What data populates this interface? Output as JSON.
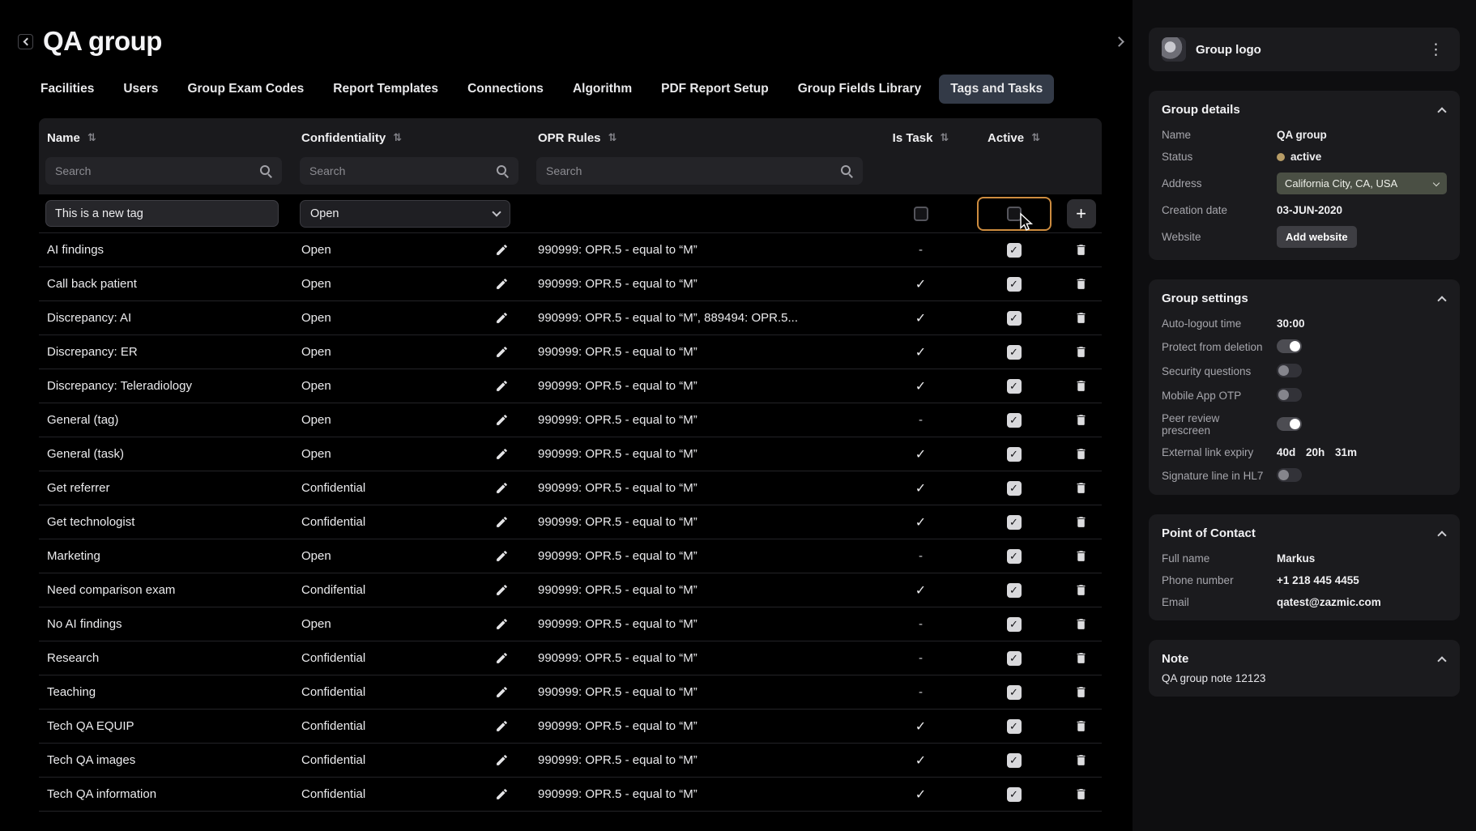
{
  "page": {
    "title": "QA group"
  },
  "icons": {
    "sort": "⇅",
    "kebab": "⋮",
    "check": "✓",
    "dash": "-"
  },
  "colors": {
    "accent_highlight": "#cd8c3f",
    "active_tab_bg": "#333a47",
    "status_dot": "#b79c66",
    "checkbox_checked": "#d9d9dc"
  },
  "tabs": [
    {
      "label": "Facilities",
      "active": false
    },
    {
      "label": "Users",
      "active": false
    },
    {
      "label": "Group Exam Codes",
      "active": false
    },
    {
      "label": "Report Templates",
      "active": false
    },
    {
      "label": "Connections",
      "active": false
    },
    {
      "label": "Algorithm",
      "active": false
    },
    {
      "label": "PDF Report Setup",
      "active": false
    },
    {
      "label": "Group Fields Library",
      "active": false
    },
    {
      "label": "Tags and Tasks",
      "active": true
    }
  ],
  "table": {
    "search_placeholder": "Search",
    "columns": [
      "Name",
      "Confidentiality",
      "OPR Rules",
      "Is Task",
      "Active"
    ],
    "new_row": {
      "name_value": "This is a new tag",
      "confidentiality": "Open",
      "is_task_checked": false,
      "active_checked": false,
      "add_label": "+"
    },
    "rows": [
      {
        "name": "AI findings",
        "confidentiality": "Open",
        "opr": "990999: OPR.5 - equal to “M”",
        "is_task": false,
        "active": true
      },
      {
        "name": "Call back patient",
        "confidentiality": "Open",
        "opr": "990999: OPR.5 - equal to “M”",
        "is_task": true,
        "active": true
      },
      {
        "name": "Discrepancy: AI",
        "confidentiality": "Open",
        "opr": "990999: OPR.5 - equal to “M”, 889494: OPR.5...",
        "is_task": true,
        "active": true
      },
      {
        "name": "Discrepancy: ER",
        "confidentiality": "Open",
        "opr": "990999: OPR.5 - equal to “M”",
        "is_task": true,
        "active": true
      },
      {
        "name": "Discrepancy: Teleradiology",
        "confidentiality": "Open",
        "opr": "990999: OPR.5 - equal to “M”",
        "is_task": true,
        "active": true
      },
      {
        "name": "General (tag)",
        "confidentiality": "Open",
        "opr": "990999: OPR.5 - equal to “M”",
        "is_task": false,
        "active": true
      },
      {
        "name": "General (task)",
        "confidentiality": "Open",
        "opr": "990999: OPR.5 - equal to “M”",
        "is_task": true,
        "active": true
      },
      {
        "name": "Get referrer",
        "confidentiality": "Confidential",
        "opr": "990999: OPR.5 - equal to “M”",
        "is_task": true,
        "active": true
      },
      {
        "name": "Get technologist",
        "confidentiality": "Confidential",
        "opr": "990999: OPR.5 - equal to “M”",
        "is_task": true,
        "active": true
      },
      {
        "name": "Marketing",
        "confidentiality": "Open",
        "opr": "990999: OPR.5 - equal to “M”",
        "is_task": false,
        "active": true
      },
      {
        "name": "Need comparison exam",
        "confidentiality": "Condifential",
        "opr": "990999: OPR.5 - equal to “M”",
        "is_task": true,
        "active": true
      },
      {
        "name": "No AI findings",
        "confidentiality": "Open",
        "opr": "990999: OPR.5 - equal to “M”",
        "is_task": false,
        "active": true
      },
      {
        "name": "Research",
        "confidentiality": "Confidential",
        "opr": "990999: OPR.5 - equal to “M”",
        "is_task": false,
        "active": true
      },
      {
        "name": "Teaching",
        "confidentiality": "Confidential",
        "opr": "990999: OPR.5 - equal to “M”",
        "is_task": false,
        "active": true
      },
      {
        "name": "Tech QA EQUIP",
        "confidentiality": "Confidential",
        "opr": "990999: OPR.5 - equal to “M”",
        "is_task": true,
        "active": true
      },
      {
        "name": "Tech QA images",
        "confidentiality": "Confidential",
        "opr": "990999: OPR.5 - equal to “M”",
        "is_task": true,
        "active": true
      },
      {
        "name": "Tech QA information",
        "confidentiality": "Confidential",
        "opr": "990999: OPR.5 - equal to “M”",
        "is_task": true,
        "active": true
      }
    ]
  },
  "side_panel": {
    "logo_card": {
      "title": "Group logo"
    },
    "group_details": {
      "title": "Group details",
      "name_label": "Name",
      "name_value": "QA group",
      "status_label": "Status",
      "status_value": "active",
      "address_label": "Address",
      "address_value": "California City, CA, USA",
      "creation_label": "Creation date",
      "creation_value": "03-JUN-2020",
      "website_label": "Website",
      "website_button": "Add website"
    },
    "group_settings": {
      "title": "Group settings",
      "rows": [
        {
          "label": "Auto-logout time",
          "value": "30:00"
        },
        {
          "label": "Protect from deletion",
          "toggle": true
        },
        {
          "label": "Security questions",
          "toggle": false
        },
        {
          "label": "Mobile App OTP",
          "toggle": false
        },
        {
          "label": "Peer review prescreen",
          "toggle": true
        },
        {
          "label": "External link expiry",
          "value": "40d 20h 31m"
        },
        {
          "label": "Signature line in HL7",
          "toggle": false
        }
      ]
    },
    "point_of_contact": {
      "title": "Point of Contact",
      "fields": [
        {
          "label": "Full name",
          "value": "Markus"
        },
        {
          "label": "Phone number",
          "value": "+1 218 445 4455"
        },
        {
          "label": "Email",
          "value": "qatest@zazmic.com"
        }
      ]
    },
    "note": {
      "title": "Note",
      "text": "QA group note 12123"
    }
  }
}
